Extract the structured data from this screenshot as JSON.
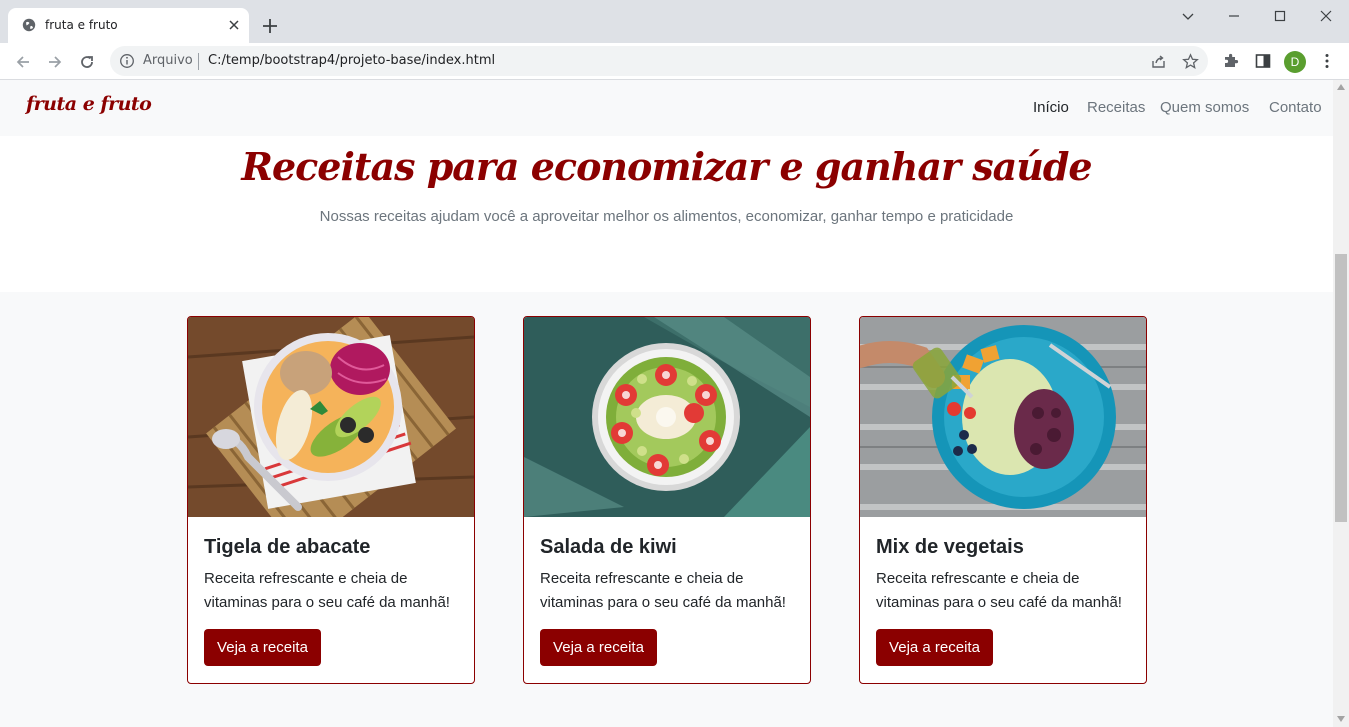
{
  "browser": {
    "tab_title": "fruta e fruto",
    "address_scheme": "Arquivo",
    "address_url": "C:/temp/bootstrap4/projeto-base/index.html",
    "profile_initial": "D",
    "icons": [
      "globe-icon",
      "close-icon",
      "plus-icon",
      "chevron-down-icon",
      "minimize-icon",
      "maximize-icon",
      "window-close-icon",
      "back-icon",
      "forward-icon",
      "reload-icon",
      "info-icon",
      "share-icon",
      "star-icon",
      "extensions-icon",
      "side-panel-icon",
      "kebab-menu-icon"
    ]
  },
  "site": {
    "brand": "fruta e fruto",
    "nav": [
      {
        "label": "Início",
        "active": true
      },
      {
        "label": "Receitas",
        "active": false
      },
      {
        "label": "Quem somos",
        "active": false
      },
      {
        "label": "Contato",
        "active": false
      }
    ],
    "hero": {
      "title": "Receitas para economizar e ganhar saúde",
      "subtitle": "Nossas receitas ajudam você a aproveitar melhor os alimentos, economizar, ganhar tempo e praticidade"
    },
    "cards": [
      {
        "title": "Tigela de abacate",
        "text": "Receita refrescante e cheia de vitaminas para o seu café da manhã!",
        "button": "Veja a receita"
      },
      {
        "title": "Salada de kiwi",
        "text": "Receita refrescante e cheia de vitaminas para o seu café da manhã!",
        "button": "Veja a receita"
      },
      {
        "title": "Mix de vegetais",
        "text": "Receita refrescante e cheia de vitaminas para o seu café da manhã!",
        "button": "Veja a receita"
      }
    ]
  },
  "colors": {
    "brand": "#8b0000",
    "muted": "#6c757d",
    "page_bg": "#f8f9fa",
    "chrome_bg": "#dee1e6",
    "avatar": "#5a9e2f"
  }
}
